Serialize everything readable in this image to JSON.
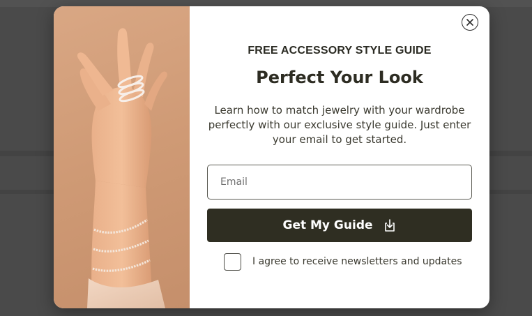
{
  "popup": {
    "eyebrow": "FREE ACCESSORY STYLE GUIDE",
    "title": "Perfect Your Look",
    "description": "Learn how to match jewelry with your wardrobe perfectly with our exclusive style guide. Just enter your email to get started.",
    "email_placeholder": "Email",
    "email_value": "",
    "submit_label": "Get My Guide",
    "submit_icon": "download-icon",
    "consent_label": "I agree to receive newsletters and updates",
    "consent_checked": false,
    "close_icon": "close-icon",
    "image_alt": "hand-with-jewelry-image"
  },
  "colors": {
    "overlay": "#4a4a4a",
    "modal_bg": "#ffffff",
    "button_bg": "#2f2e22",
    "text_dark": "#2d2c22",
    "image_tone": "#d9a784"
  }
}
